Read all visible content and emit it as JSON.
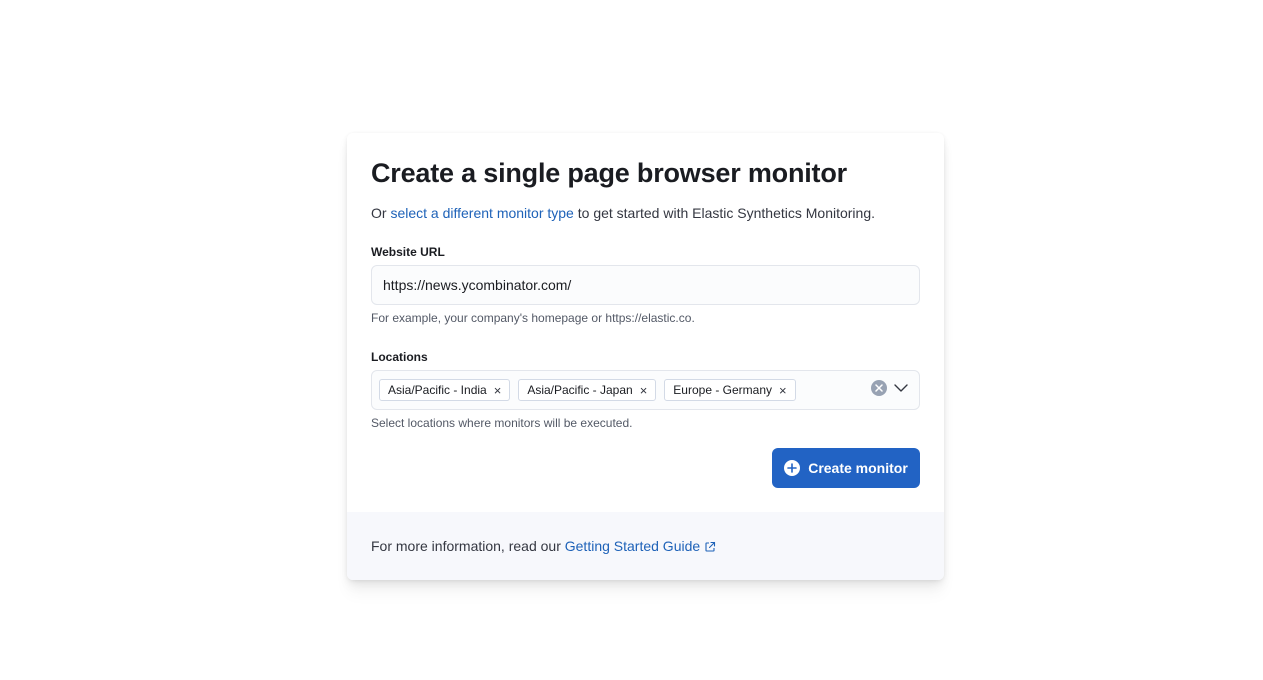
{
  "header": {
    "title": "Create a single page browser monitor",
    "subtitle_prefix": "Or",
    "subtitle_link": "select a different monitor type",
    "subtitle_suffix": "to get started with Elastic Synthetics Monitoring."
  },
  "url_field": {
    "label": "Website URL",
    "value": "https://news.ycombinator.com/",
    "help": "For example, your company's homepage or https://elastic.co."
  },
  "locations_field": {
    "label": "Locations",
    "selected": [
      {
        "label": "Asia/Pacific - India",
        "remove_glyph": "×"
      },
      {
        "label": "Asia/Pacific - Japan",
        "remove_glyph": "×"
      },
      {
        "label": "Europe - Germany",
        "remove_glyph": "×"
      }
    ],
    "help": "Select locations where monitors will be executed."
  },
  "actions": {
    "create_label": "Create monitor",
    "create_icon": "plus-in-circle-icon"
  },
  "footer": {
    "prefix": "For more information, read our",
    "link": "Getting Started Guide",
    "link_icon": "external-link-icon"
  },
  "colors": {
    "accent": "#2263c4",
    "link": "#1e62b8",
    "footer_bg": "#f7f8fc"
  }
}
